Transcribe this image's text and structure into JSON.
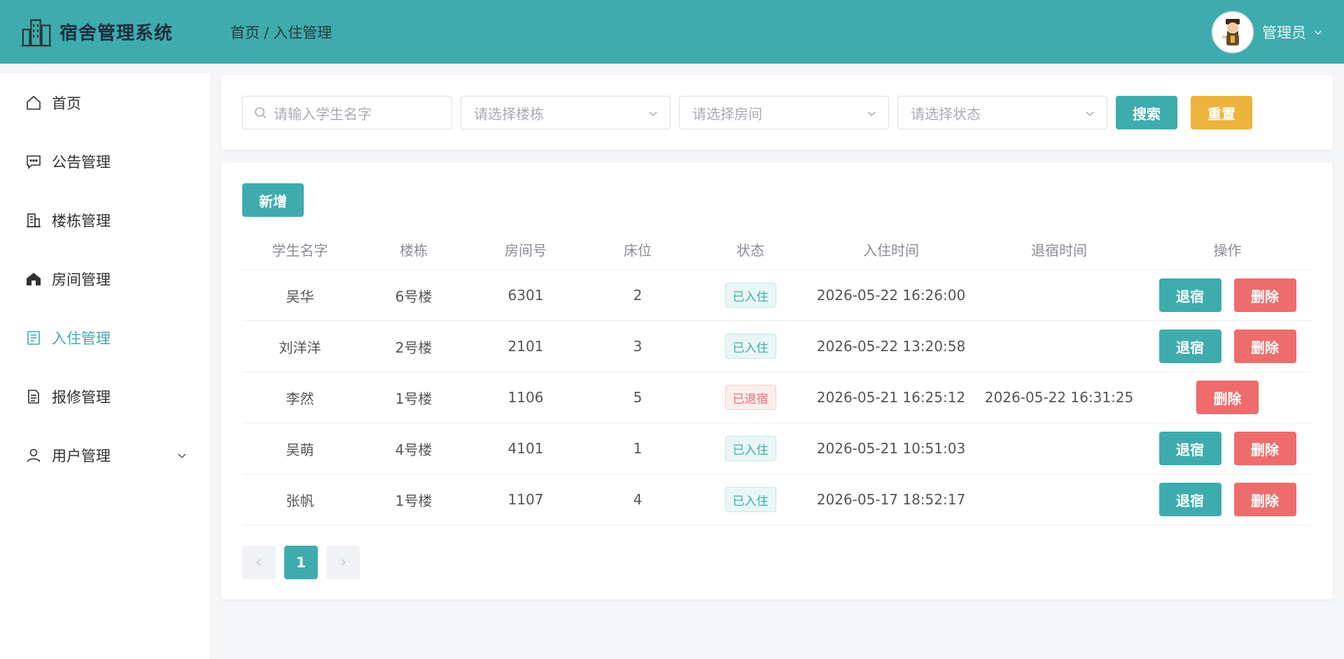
{
  "app": {
    "title": "宿舍管理系统"
  },
  "header": {
    "breadcrumb": [
      "首页",
      "入住管理"
    ],
    "breadcrumb_sep": "/",
    "user_name": "管理员",
    "accent": "#3eacad"
  },
  "sidebar": {
    "items": [
      {
        "label": "首页",
        "icon": "home-icon"
      },
      {
        "label": "公告管理",
        "icon": "message-icon"
      },
      {
        "label": "楼栋管理",
        "icon": "building-icon"
      },
      {
        "label": "房间管理",
        "icon": "house-icon"
      },
      {
        "label": "入住管理",
        "icon": "document-icon",
        "active": true
      },
      {
        "label": "报修管理",
        "icon": "report-icon"
      },
      {
        "label": "用户管理",
        "icon": "user-icon",
        "has_submenu": true
      }
    ]
  },
  "search": {
    "name_placeholder": "请输入学生名字",
    "building_placeholder": "请选择楼栋",
    "room_placeholder": "请选择房间",
    "status_placeholder": "请选择状态",
    "search_label": "搜索",
    "reset_label": "重置"
  },
  "table": {
    "add_label": "新增",
    "columns": [
      "学生名字",
      "楼栋",
      "房间号",
      "床位",
      "状态",
      "入住时间",
      "退宿时间",
      "操作"
    ],
    "checkout_label": "退宿",
    "delete_label": "删除",
    "rows": [
      {
        "name": "吴华",
        "building": "6号楼",
        "room": "6301",
        "bed": "2",
        "status": "已入住",
        "checkin": "2026-05-22 16:26:00",
        "checkout": ""
      },
      {
        "name": "刘洋洋",
        "building": "2号楼",
        "room": "2101",
        "bed": "3",
        "status": "已入住",
        "checkin": "2026-05-22 13:20:58",
        "checkout": ""
      },
      {
        "name": "李然",
        "building": "1号楼",
        "room": "1106",
        "bed": "5",
        "status": "已退宿",
        "checkin": "2026-05-21 16:25:12",
        "checkout": "2026-05-22 16:31:25"
      },
      {
        "name": "吴萌",
        "building": "4号楼",
        "room": "4101",
        "bed": "1",
        "status": "已入住",
        "checkin": "2026-05-21 10:51:03",
        "checkout": ""
      },
      {
        "name": "张帆",
        "building": "1号楼",
        "room": "1107",
        "bed": "4",
        "status": "已入住",
        "checkin": "2026-05-17 18:52:17",
        "checkout": ""
      }
    ]
  },
  "pagination": {
    "current": "1",
    "prev_icon": "chevron-left-icon",
    "next_icon": "chevron-right-icon"
  }
}
